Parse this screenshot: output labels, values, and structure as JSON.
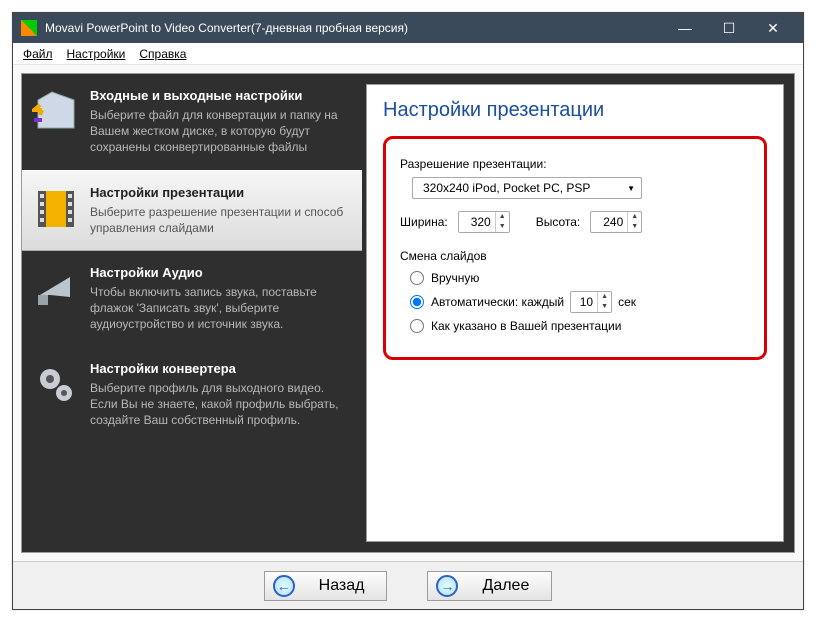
{
  "window": {
    "title": "Movavi PowerPoint to Video Converter(7-дневная пробная версия)"
  },
  "menu": {
    "file": "Файл",
    "settings": "Настройки",
    "help": "Справка"
  },
  "sidebar": {
    "items": [
      {
        "title": "Входные и выходные настройки",
        "desc": "Выберите файл для конвертации и папку на Вашем жестком диске, в которую будут сохранены сконвертированные файлы"
      },
      {
        "title": "Настройки презентации",
        "desc": "Выберите разрешение презентации и способ управления слайдами"
      },
      {
        "title": "Настройки Аудио",
        "desc": "Чтобы включить запись звука, поставьте флажок 'Записать звук', выберите аудиоустройство и источник звука."
      },
      {
        "title": "Настройки конвертера",
        "desc": "Выберите профиль для выходного видео. Если Вы не знаете, какой профиль выбрать, создайте Ваш собственный профиль."
      }
    ]
  },
  "panel": {
    "heading": "Настройки презентации",
    "resolution_label": "Разрешение презентации:",
    "resolution_value": "320x240 iPod, Pocket PC, PSP",
    "width_label": "Ширина:",
    "width_value": "320",
    "height_label": "Высота:",
    "height_value": "240",
    "slides_label": "Смена слайдов",
    "radio_manual": "Вручную",
    "radio_auto_prefix": "Автоматически: каждый",
    "radio_auto_interval": "10",
    "radio_auto_suffix": "сек",
    "radio_asin": "Как указано в Вашей презентации"
  },
  "footer": {
    "back": "Назад",
    "next": "Далее"
  }
}
